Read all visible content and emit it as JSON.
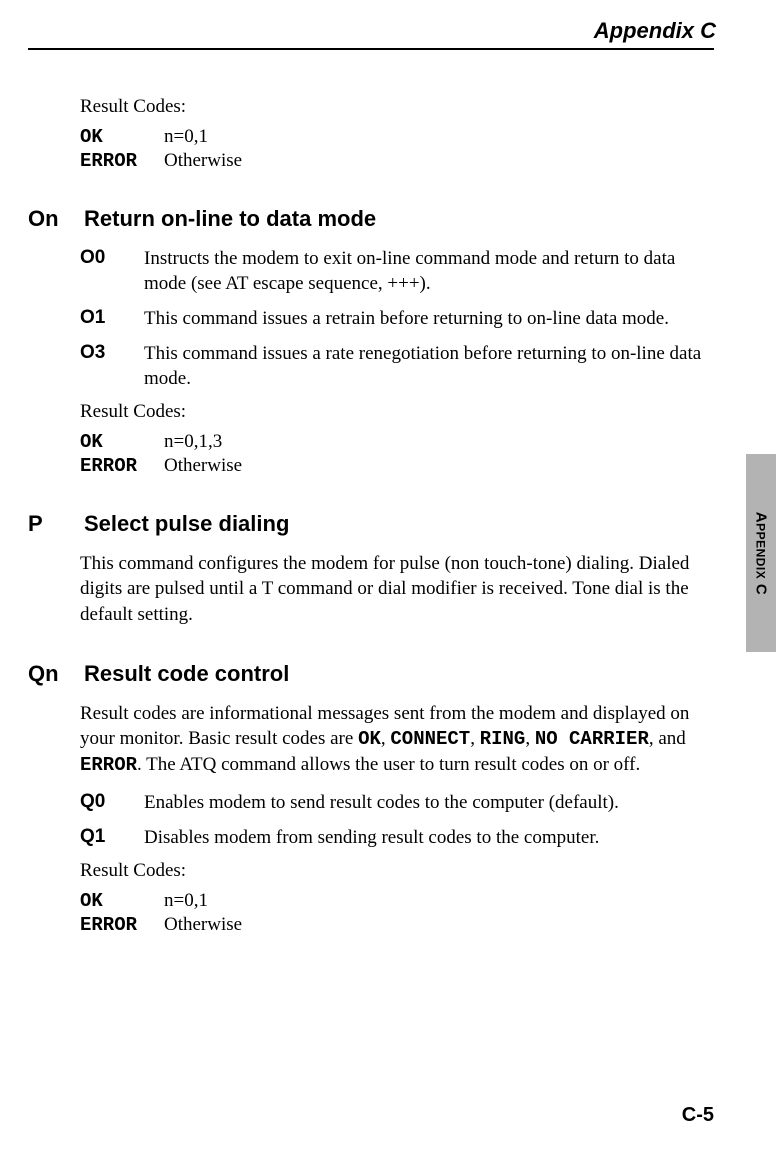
{
  "header": {
    "appendix": "Appendix C"
  },
  "sidebar": {
    "label_prefix": "A",
    "label_rest": "PPENDIX",
    "label_suffix": " C"
  },
  "footer": {
    "page": "C-5"
  },
  "intro_results": {
    "label": "Result Codes:",
    "rows": [
      {
        "code": "OK",
        "desc": "n=0,1"
      },
      {
        "code": "ERROR",
        "desc": "Otherwise"
      }
    ]
  },
  "sections": [
    {
      "code": "On",
      "title": "Return on-line to data mode",
      "commands": [
        {
          "key": "O0",
          "desc": "Instructs the modem to exit on-line command mode and return to data mode (see AT escape sequence, +++)."
        },
        {
          "key": "O1",
          "desc": "This command issues a retrain before returning to on-line data mode."
        },
        {
          "key": "O3",
          "desc": "This command issues a rate renegotiation before returning to on-line data mode."
        }
      ],
      "results": {
        "label": "Result Codes:",
        "rows": [
          {
            "code": "OK",
            "desc": "n=0,1,3"
          },
          {
            "code": "ERROR",
            "desc": "Otherwise"
          }
        ]
      }
    },
    {
      "code": "P",
      "title": "Select pulse dialing",
      "para": "This command configures the modem for pulse (non touch-tone) dialing. Dialed digits are pulsed until a T command or dial modifier is received. Tone dial is the default setting."
    },
    {
      "code": "Qn",
      "title": "Result code control",
      "para_pre": "Result codes are informational messages sent from the modem and displayed on your monitor. Basic result codes are ",
      "para_codes": [
        "OK",
        "CONNECT",
        "RING",
        "NO CARRIER",
        "ERROR"
      ],
      "para_mid": ". The ATQ command allows the user to turn result codes on or off.",
      "commands": [
        {
          "key": "Q0",
          "desc": "Enables modem to send result codes to the computer (default)."
        },
        {
          "key": "Q1",
          "desc": "Disables modem from sending result codes to the computer."
        }
      ],
      "results": {
        "label": "Result Codes:",
        "rows": [
          {
            "code": "OK",
            "desc": "n=0,1"
          },
          {
            "code": "ERROR",
            "desc": "Otherwise"
          }
        ]
      }
    }
  ]
}
